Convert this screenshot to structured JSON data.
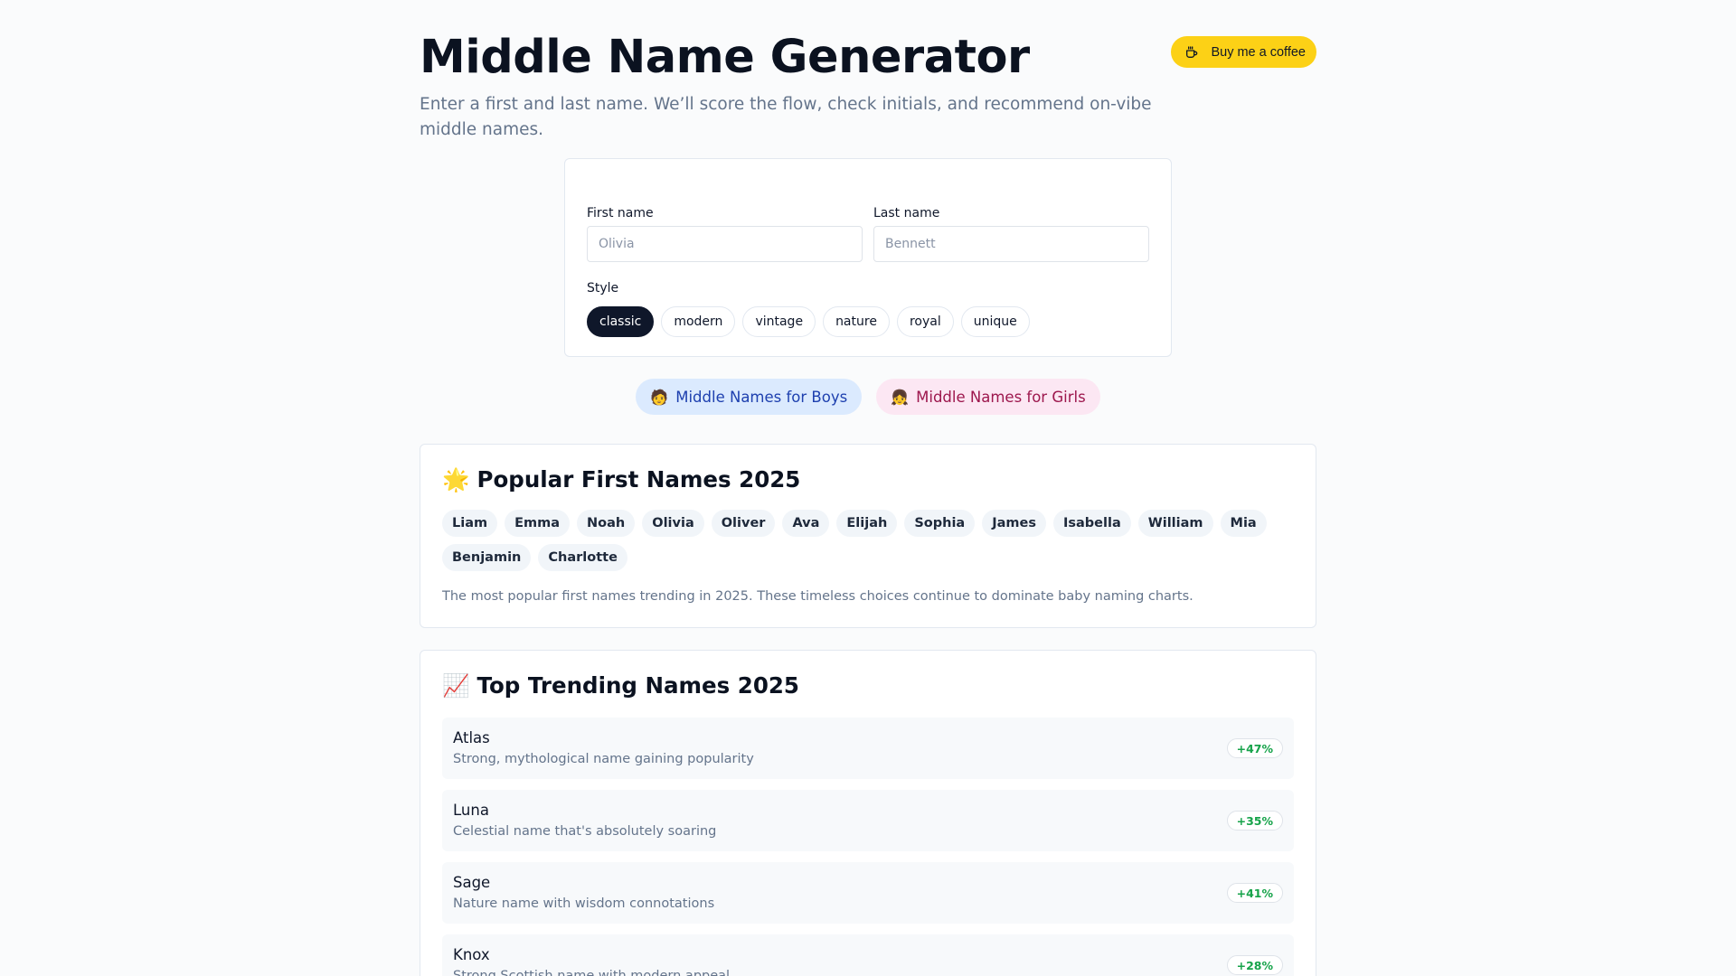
{
  "header": {
    "title": "Middle Name Generator",
    "subtitle": "Enter a first and last name. We’ll score the flow, check initials, and recommend on-vibe middle names.",
    "coffee_label": "Buy me a coffee"
  },
  "form": {
    "first_name": {
      "label": "First name",
      "placeholder": "Olivia",
      "value": ""
    },
    "last_name": {
      "label": "Last name",
      "placeholder": "Bennett",
      "value": ""
    },
    "style_label": "Style",
    "styles": [
      {
        "label": "classic",
        "selected": true
      },
      {
        "label": "modern",
        "selected": false
      },
      {
        "label": "vintage",
        "selected": false
      },
      {
        "label": "nature",
        "selected": false
      },
      {
        "label": "royal",
        "selected": false
      },
      {
        "label": "unique",
        "selected": false
      }
    ]
  },
  "gender_links": {
    "boys": {
      "emoji": "🧑",
      "label": "Middle Names for Boys"
    },
    "girls": {
      "emoji": "👧",
      "label": "Middle Names for Girls"
    }
  },
  "popular": {
    "emoji": "🌟",
    "title": "Popular First Names 2025",
    "names": [
      "Liam",
      "Emma",
      "Noah",
      "Olivia",
      "Oliver",
      "Ava",
      "Elijah",
      "Sophia",
      "James",
      "Isabella",
      "William",
      "Mia",
      "Benjamin",
      "Charlotte"
    ],
    "description": "The most popular first names trending in 2025. These timeless choices continue to dominate baby naming charts."
  },
  "trending": {
    "emoji": "📈",
    "title": "Top Trending Names 2025",
    "items": [
      {
        "name": "Atlas",
        "description": "Strong, mythological name gaining popularity",
        "growth": "+47%"
      },
      {
        "name": "Luna",
        "description": "Celestial name that's absolutely soaring",
        "growth": "+35%"
      },
      {
        "name": "Sage",
        "description": "Nature name with wisdom connotations",
        "growth": "+41%"
      },
      {
        "name": "Knox",
        "description": "Strong Scottish name with modern appeal",
        "growth": "+28%"
      }
    ]
  },
  "colors": {
    "accent_dark": "#0f172a",
    "coffee_yellow": "#fcd116",
    "boys_bg": "#dbeafe",
    "girls_bg": "#fce7f3",
    "growth_green": "#16a34a"
  }
}
